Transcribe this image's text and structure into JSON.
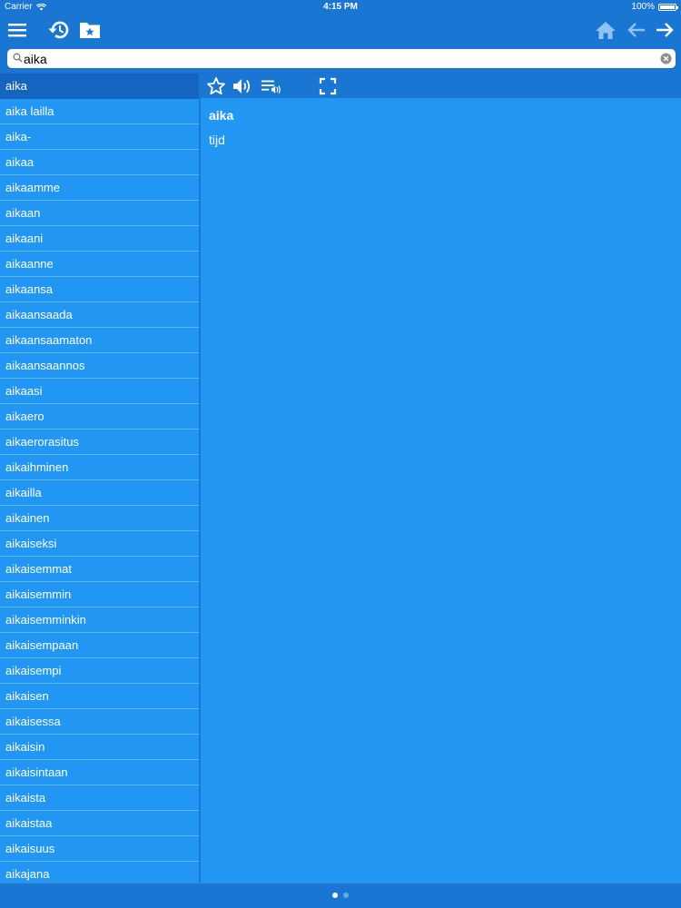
{
  "status_bar": {
    "carrier": "Carrier",
    "time": "4:15 PM",
    "battery": "100%"
  },
  "toolbar": {
    "icons": [
      "menu-icon",
      "history-icon",
      "favorites-folder-icon",
      "home-icon",
      "back-arrow-icon",
      "forward-arrow-icon"
    ]
  },
  "search": {
    "value": "aika",
    "placeholder": ""
  },
  "word_list": {
    "selected_index": 0,
    "items": [
      "aika",
      "aika lailla",
      "aika-",
      "aikaa",
      "aikaamme",
      "aikaan",
      "aikaani",
      "aikaanne",
      "aikaansa",
      "aikaansaada",
      "aikaansaamaton",
      "aikaansaannos",
      "aikaasi",
      "aikaero",
      "aikaerorasitus",
      "aikaihminen",
      "aikailla",
      "aikainen",
      "aikaiseksi",
      "aikaisemmat",
      "aikaisemmin",
      "aikaisemminkin",
      "aikaisempaan",
      "aikaisempi",
      "aikaisen",
      "aikaisessa",
      "aikaisin",
      "aikaisintaan",
      "aikaista",
      "aikaistaa",
      "aikaisuus",
      "aikajana"
    ]
  },
  "detail": {
    "tools": [
      "star-icon",
      "speaker-icon",
      "playlist-audio-icon",
      "fullscreen-icon"
    ],
    "headword": "aika",
    "definition": "tijd"
  },
  "pager": {
    "pages": 2,
    "current": 1
  },
  "colors": {
    "bar": "#1976d2",
    "pane": "#2196f3",
    "selected": "#1565c0"
  }
}
